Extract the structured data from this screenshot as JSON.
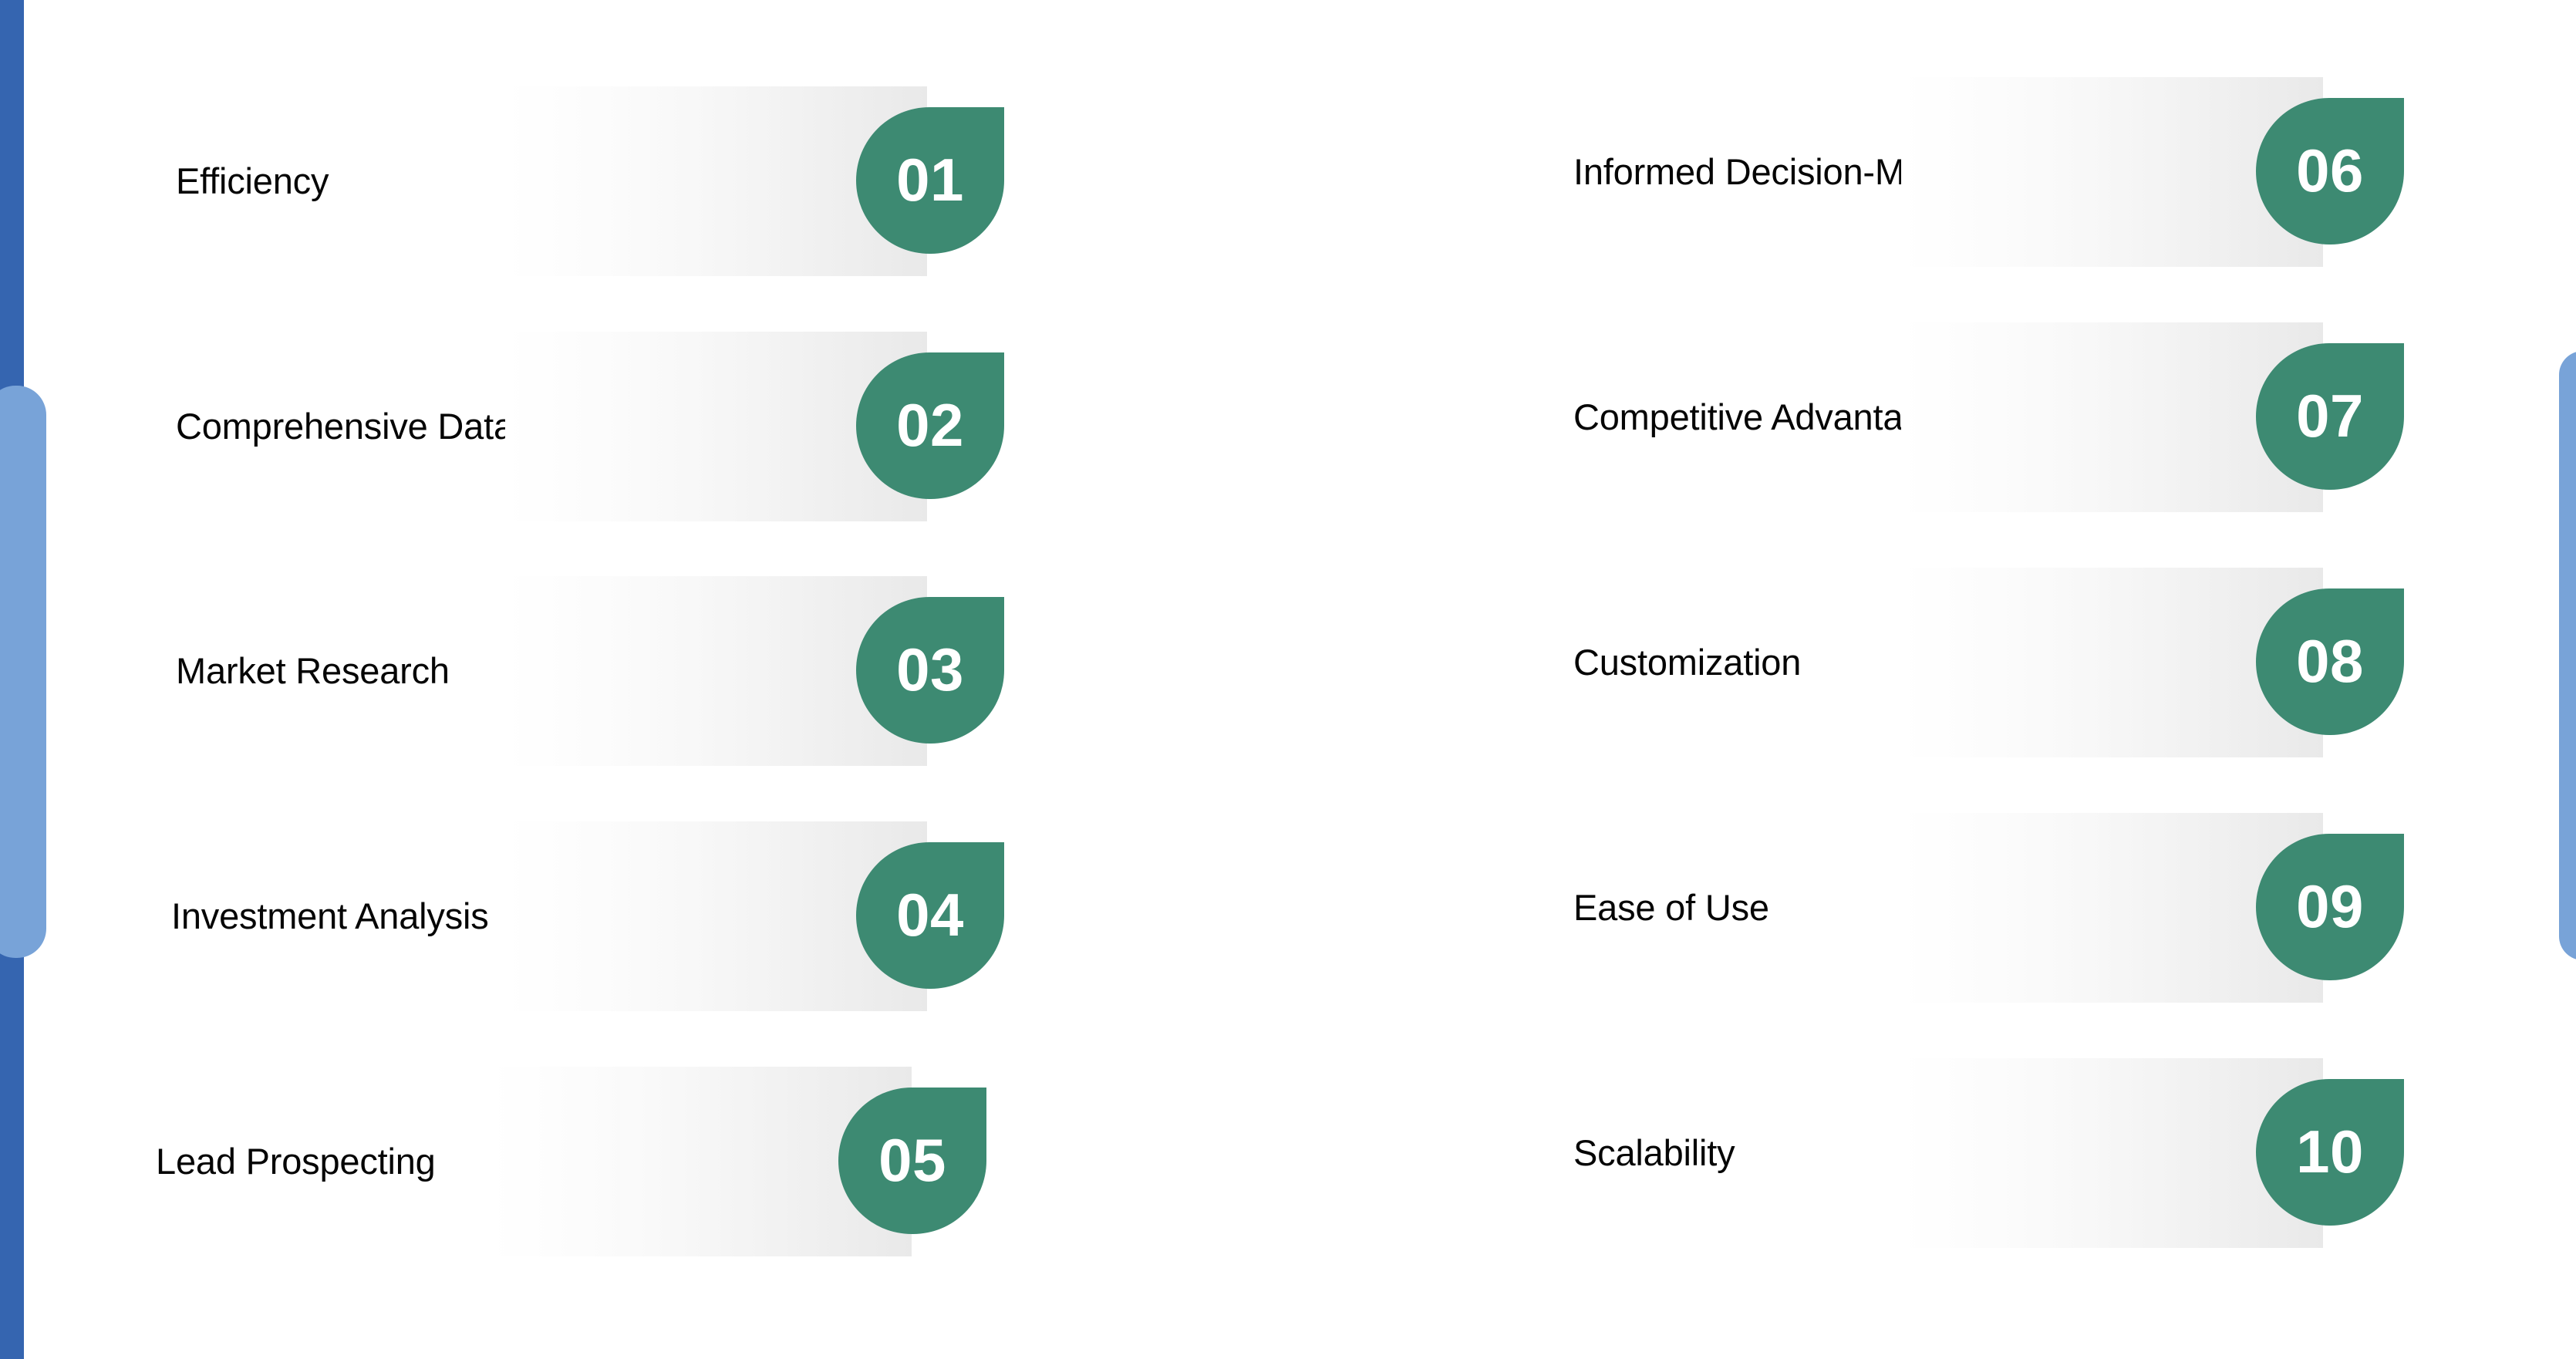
{
  "theme": {
    "accent_green": "#3d8a72",
    "rail_blue": "#3565b0",
    "scrollbar_blue": "#78a3d8",
    "text_color": "#050505",
    "bar_gradient_start": "#ffffff",
    "bar_gradient_end": "#e9e9e9"
  },
  "columns": {
    "left": {
      "items": [
        {
          "number": "01",
          "label": "Efficiency"
        },
        {
          "number": "02",
          "label": "Comprehensive Data"
        },
        {
          "number": "03",
          "label": "Market Research"
        },
        {
          "number": "04",
          "label": "Investment Analysis"
        },
        {
          "number": "05",
          "label": "Lead Prospecting"
        }
      ]
    },
    "right": {
      "items": [
        {
          "number": "06",
          "label": "Informed Decision-Making"
        },
        {
          "number": "07",
          "label": "Competitive Advantage"
        },
        {
          "number": "08",
          "label": "Customization"
        },
        {
          "number": "09",
          "label": "Ease of Use"
        },
        {
          "number": "10",
          "label": "Scalability"
        }
      ]
    }
  },
  "scrollbars": {
    "left_thumb": "vertical-scrollbar-thumb",
    "right_thumb": "vertical-scrollbar-thumb"
  }
}
